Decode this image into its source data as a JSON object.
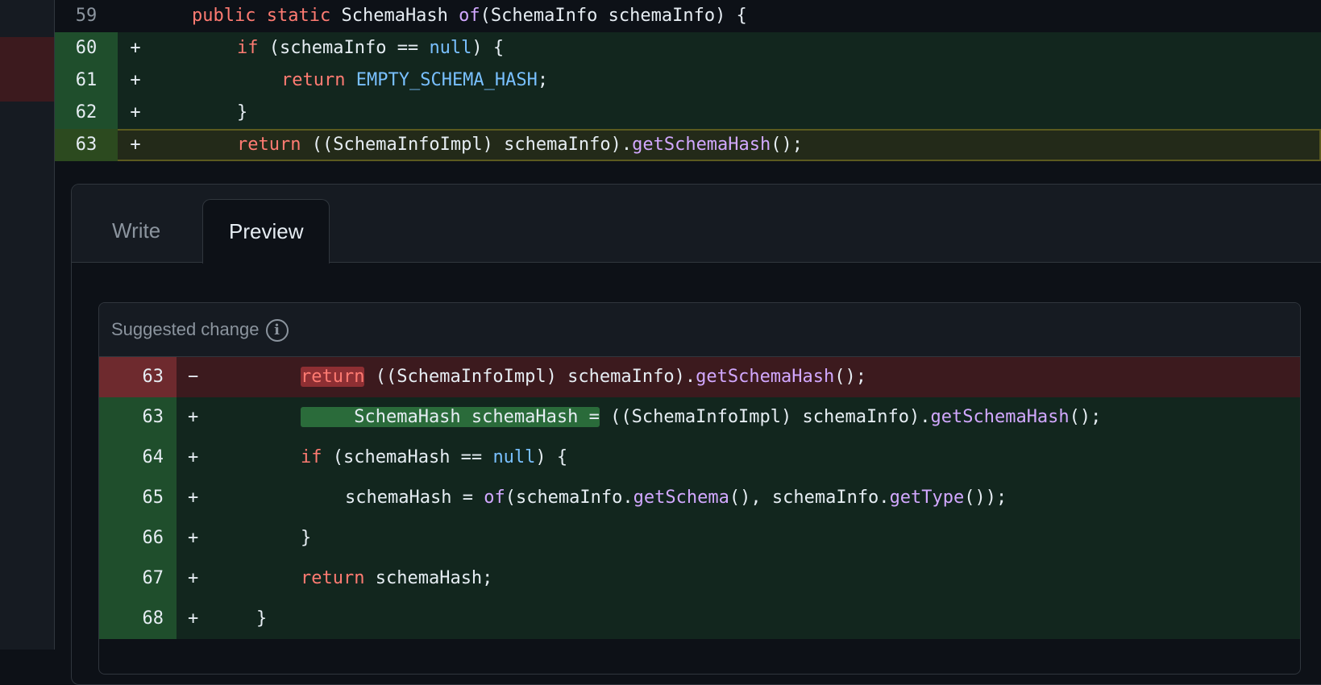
{
  "diff": {
    "rows": [
      {
        "ln": "59",
        "sign": "",
        "type": "ctx"
      },
      {
        "ln": "60",
        "sign": "+",
        "type": "add"
      },
      {
        "ln": "61",
        "sign": "+",
        "type": "add"
      },
      {
        "ln": "62",
        "sign": "+",
        "type": "add"
      },
      {
        "ln": "63",
        "sign": "+",
        "type": "hl"
      }
    ],
    "tok": {
      "public": "public",
      "static": "static",
      "schema_hash_type": "SchemaHash",
      "of": "of",
      "params": "(SchemaInfo schemaInfo) {",
      "if": "if",
      "schemainfo_eq": "(schemaInfo ==",
      "null": "null",
      "close_brace_open": ") {",
      "return": "return",
      "empty_hash": "EMPTY_SCHEMA_HASH",
      "semicolon": ";",
      "close_brace": "}",
      "cast_expr": "((SchemaInfoImpl) schemaInfo).",
      "get_schema_hash": "getSchemaHash",
      "call_end": "();"
    }
  },
  "tabs": {
    "write": "Write",
    "preview": "Preview"
  },
  "suggestion": {
    "title": "Suggested change",
    "info_icon": "i",
    "rows": [
      {
        "ln": "63",
        "sign": "−"
      },
      {
        "ln": "63",
        "sign": "+"
      },
      {
        "ln": "64",
        "sign": "+"
      },
      {
        "ln": "65",
        "sign": "+"
      },
      {
        "ln": "66",
        "sign": "+"
      },
      {
        "ln": "67",
        "sign": "+"
      },
      {
        "ln": "68",
        "sign": "+"
      }
    ],
    "tok": {
      "return": "return",
      "cast_expr": " ((SchemaInfoImpl) schemaInfo).",
      "get_schema_hash": "getSchemaHash",
      "call_end": "();",
      "new_decl": "     SchemaHash schemaHash =",
      "cast_expr2": " ((SchemaInfoImpl) schemaInfo).",
      "if": "if",
      "hash_eq": " (schemaHash ==",
      "null": "null",
      "close_brace_open": ") {",
      "assign": "schemaHash =",
      "of": "of",
      "get_schema_pre": "(schemaInfo.",
      "get_schema": "getSchema",
      "mid": "(), schemaInfo.",
      "get_type": "getType",
      "end_call": "());",
      "close_brace": "}",
      "return_rest": " schemaHash;",
      "close_brace2": "}"
    }
  },
  "colors": {
    "keyword": "#ff7b72",
    "function": "#d2a8ff",
    "constant": "#79c0ff",
    "added_bg": "#12261e",
    "deleted_bg": "#3c1a1e"
  }
}
